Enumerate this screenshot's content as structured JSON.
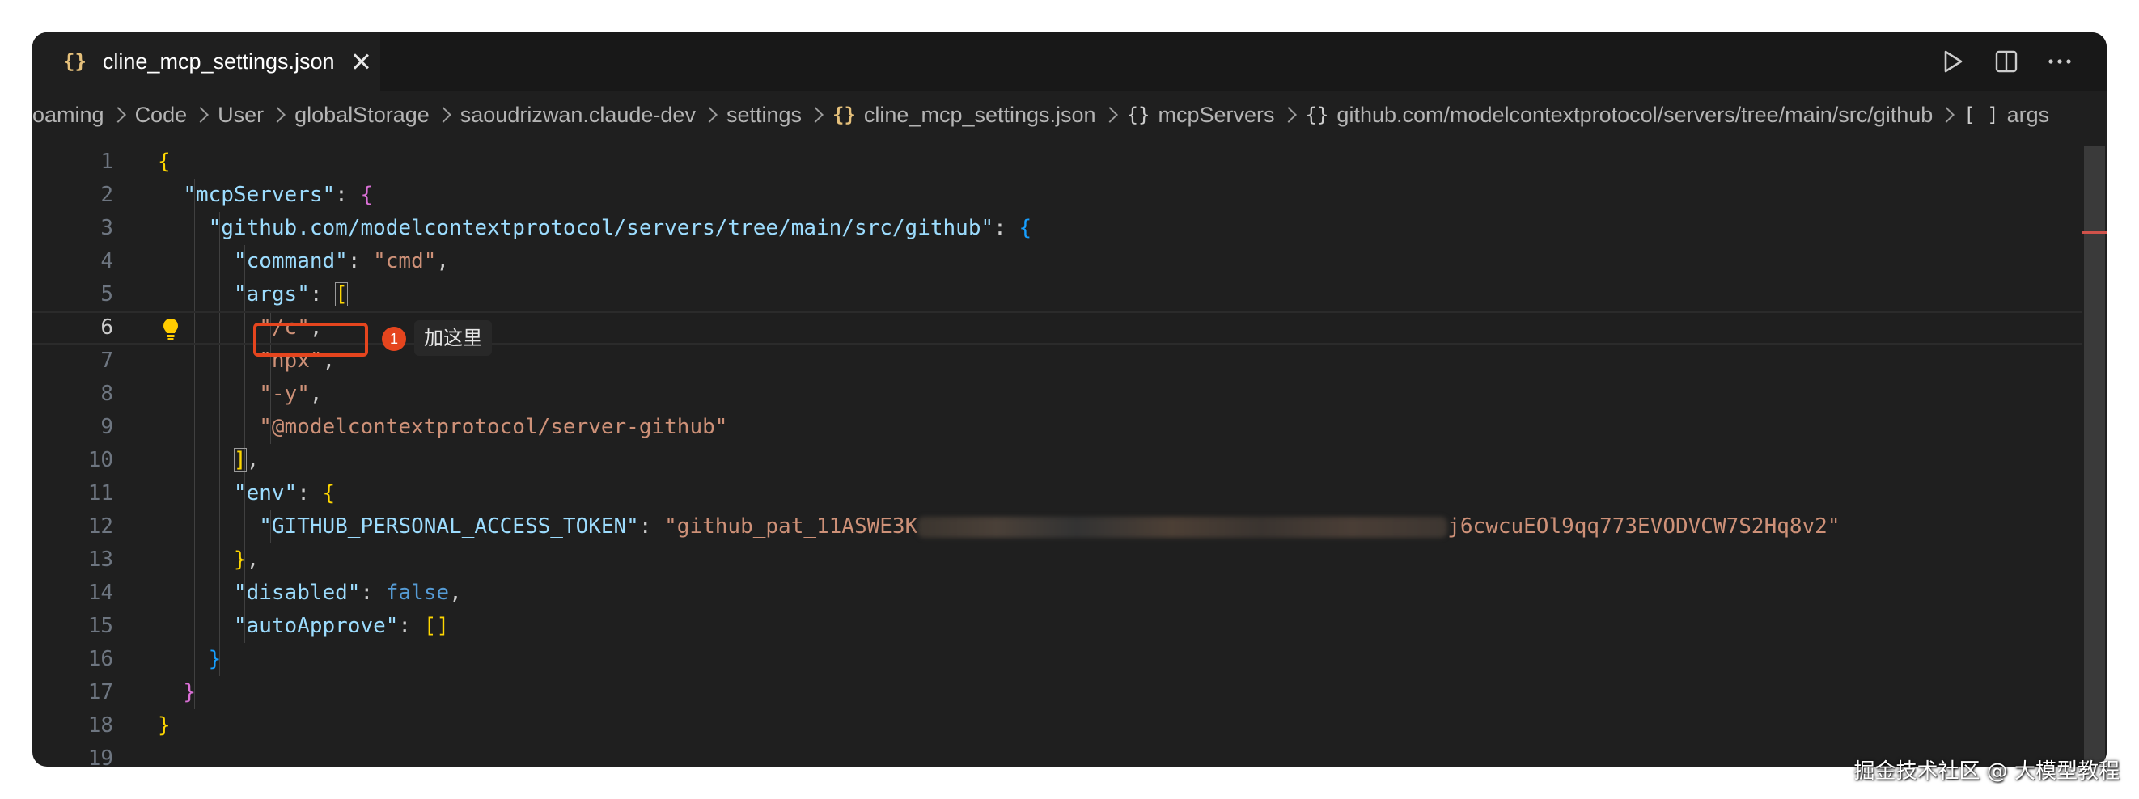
{
  "tab": {
    "icon": "json-braces-icon",
    "label": "cline_mcp_settings.json"
  },
  "actions": [
    "run-icon",
    "split-editor-icon",
    "more-icon"
  ],
  "breadcrumb": {
    "path": [
      "oaming",
      "Code",
      "User",
      "globalStorage",
      "saoudrizwan.claude-dev",
      "settings"
    ],
    "file": "cline_mcp_settings.json",
    "json_path": [
      {
        "icon": "{}",
        "label": "mcpServers"
      },
      {
        "icon": "{}",
        "label": "github.com/modelcontextprotocol/servers/tree/main/src/github"
      },
      {
        "icon": "[ ]",
        "label": "args"
      }
    ]
  },
  "code": {
    "line_numbers": [
      "1",
      "2",
      "3",
      "4",
      "5",
      "6",
      "7",
      "8",
      "9",
      "10",
      "11",
      "12",
      "13",
      "14",
      "15",
      "16",
      "17",
      "18",
      "19"
    ],
    "current_line": "6",
    "k_mcpServers": "\"mcpServers\"",
    "k_server": "\"github.com/modelcontextprotocol/servers/tree/main/src/github\"",
    "k_command": "\"command\"",
    "v_command": "\"cmd\"",
    "k_args": "\"args\"",
    "args": [
      "\"/c\"",
      "\"npx\"",
      "\"-y\"",
      "\"@modelcontextprotocol/server-github\""
    ],
    "k_env": "\"env\"",
    "k_token": "\"GITHUB_PERSONAL_ACCESS_TOKEN\"",
    "token_start": "\"github_pat_11ASWE3K",
    "token_end": "j6cwcuEOl9qq773EVODVCW7S2Hq8v2\"",
    "k_disabled": "\"disabled\"",
    "v_disabled": "false",
    "k_autoApprove": "\"autoApprove\"",
    "v_autoApprove": "[]"
  },
  "annotation": {
    "step": "1",
    "text": "加这里",
    "color": "#e5451e"
  },
  "watermark": "掘金技术社区 @ 大模型教程"
}
